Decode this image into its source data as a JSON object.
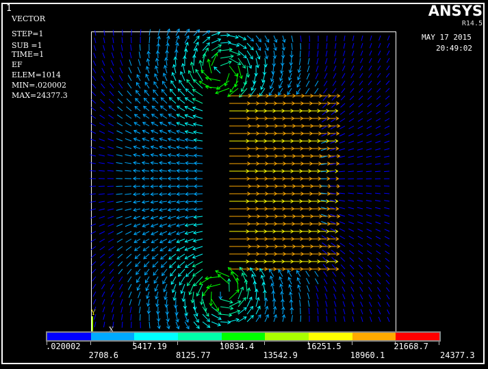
{
  "window_number": "1",
  "info": {
    "title": "VECTOR",
    "lines": [
      "STEP=1",
      "SUB =1",
      "TIME=1",
      "EF",
      "ELEM=1014",
      "MIN=.020002",
      "MAX=24377.3"
    ]
  },
  "brand": {
    "name": "ANSYS",
    "version": "R14.5"
  },
  "date": "MAY 17 2015",
  "time": "20:49:02",
  "axes": {
    "y_label": "Y",
    "x_label": "X"
  },
  "legend": {
    "colors": [
      "#0000ff",
      "#00aaff",
      "#00ffff",
      "#00ffaa",
      "#00ff00",
      "#aaff00",
      "#ffff00",
      "#ffaa00",
      "#ff0000"
    ],
    "labels": [
      ".020002",
      "2708.6",
      "5417.19",
      "8125.77",
      "10834.4",
      "13542.9",
      "16251.5",
      "18960.1",
      "21668.7",
      "24377.3"
    ]
  }
}
